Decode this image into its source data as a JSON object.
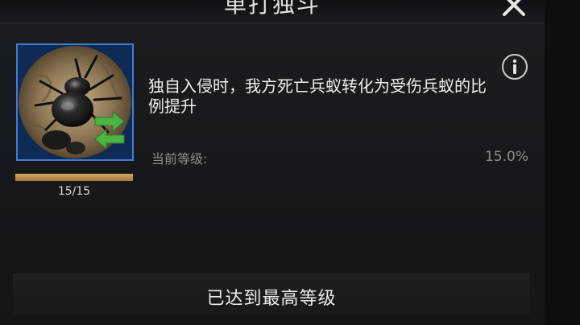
{
  "dialog": {
    "title": "单打独斗"
  },
  "skill": {
    "icon": "ant-swap-icon",
    "level_progress": 1.0,
    "level_count": "15/15",
    "description": "独自入侵时，我方死亡兵蚁转化为受伤兵蚁的比例提升",
    "current_level_label": "当前等级:",
    "current_level_value": "15.0%"
  },
  "footer": {
    "status_text": "已达到最高等级"
  },
  "colors": {
    "accent_blue": "#3c7dd4",
    "bar_gold": "#c89a57",
    "arrow_green": "#4bb543"
  }
}
